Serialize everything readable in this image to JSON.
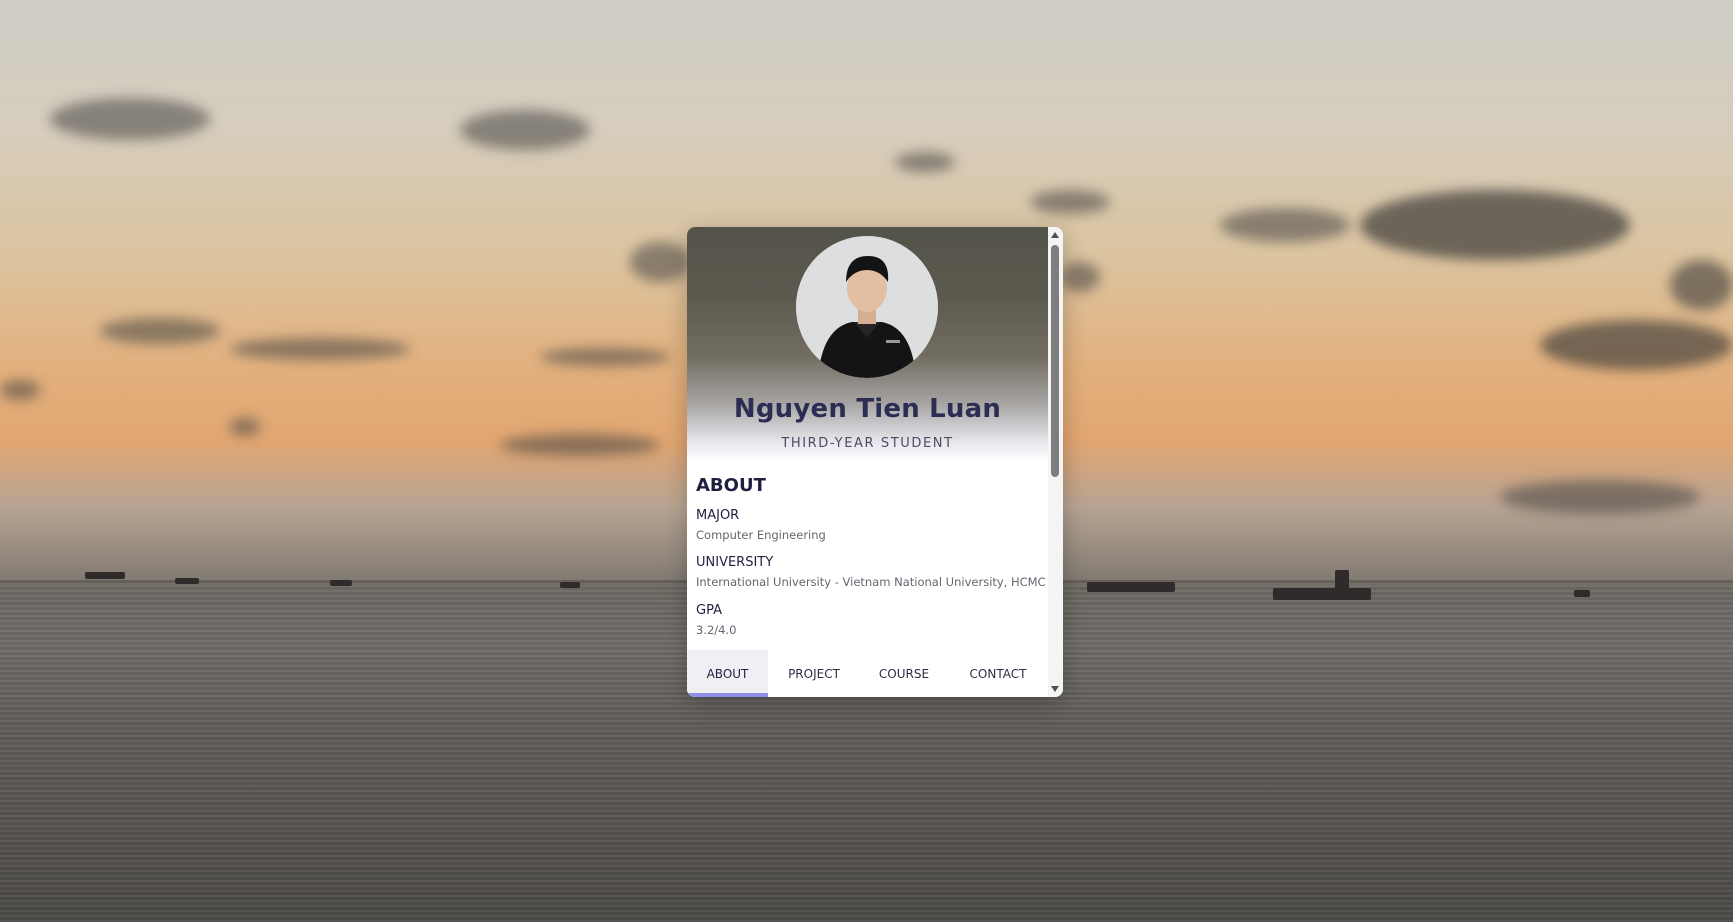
{
  "profile": {
    "name": "Nguyen Tien Luan",
    "title": "THIRD-YEAR STUDENT"
  },
  "about": {
    "heading": "ABOUT",
    "fields": [
      {
        "label": "MAJOR",
        "value": "Computer Engineering"
      },
      {
        "label": "UNIVERSITY",
        "value": "International University - Vietnam National University, HCMC"
      },
      {
        "label": "GPA",
        "value": "3.2/4.0"
      }
    ]
  },
  "tabs": [
    {
      "label": "ABOUT",
      "active": true
    },
    {
      "label": "PROJECT",
      "active": false
    },
    {
      "label": "COURSE",
      "active": false
    },
    {
      "label": "CONTACT",
      "active": false
    }
  ],
  "colors": {
    "name_text": "#2b2d52",
    "tab_indicator": "#8e8fe8"
  }
}
